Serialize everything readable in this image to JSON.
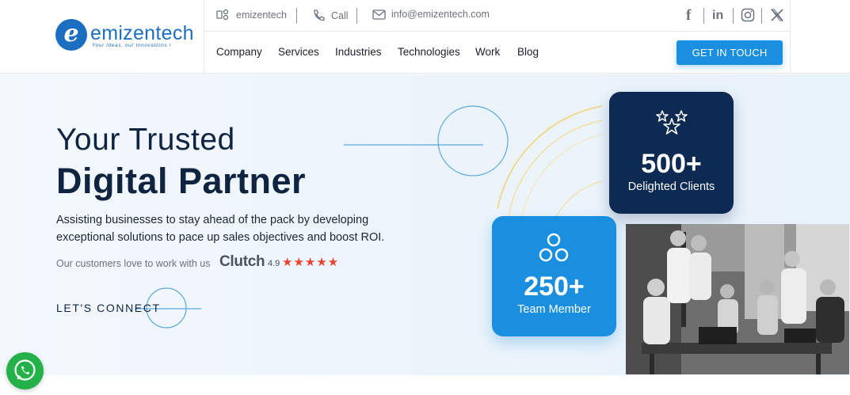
{
  "brand": {
    "name": "emizentech",
    "tagline": "Your Ideas, our Innovations !",
    "color": "#1c6fc0"
  },
  "topbar": {
    "skype_label": "emizentech",
    "call_label": "Call",
    "email_label": "info@emizentech.com",
    "social_icons": [
      "facebook-icon",
      "linkedin-icon",
      "instagram-icon",
      "x-icon"
    ]
  },
  "nav": {
    "items": [
      "Company",
      "Services",
      "Industries",
      "Technologies",
      "Work",
      "Blog"
    ],
    "cta_label": "GET IN TOUCH",
    "cta_color": "#1a8fdf"
  },
  "hero": {
    "title_line1": "Your Trusted",
    "title_line2": "Digital Partner",
    "description": "Assisting businesses to stay ahead of the pack by developing exceptional solutions to pace up sales objectives and boost ROI.",
    "customers_text": "Our customers love to work with us",
    "clutch_label": "Clutch",
    "clutch_rating": "4.9",
    "star_count": 5,
    "connect_label": "LET'S CONNECT"
  },
  "stats": [
    {
      "value": "500+",
      "label": "Delighted Clients",
      "icon": "stars-icon",
      "color": "#0d2a52"
    },
    {
      "value": "250+",
      "label": "Team Member",
      "icon": "team-icon",
      "color": "#1a8fdf"
    }
  ],
  "whatsapp_color": "#25b14a"
}
